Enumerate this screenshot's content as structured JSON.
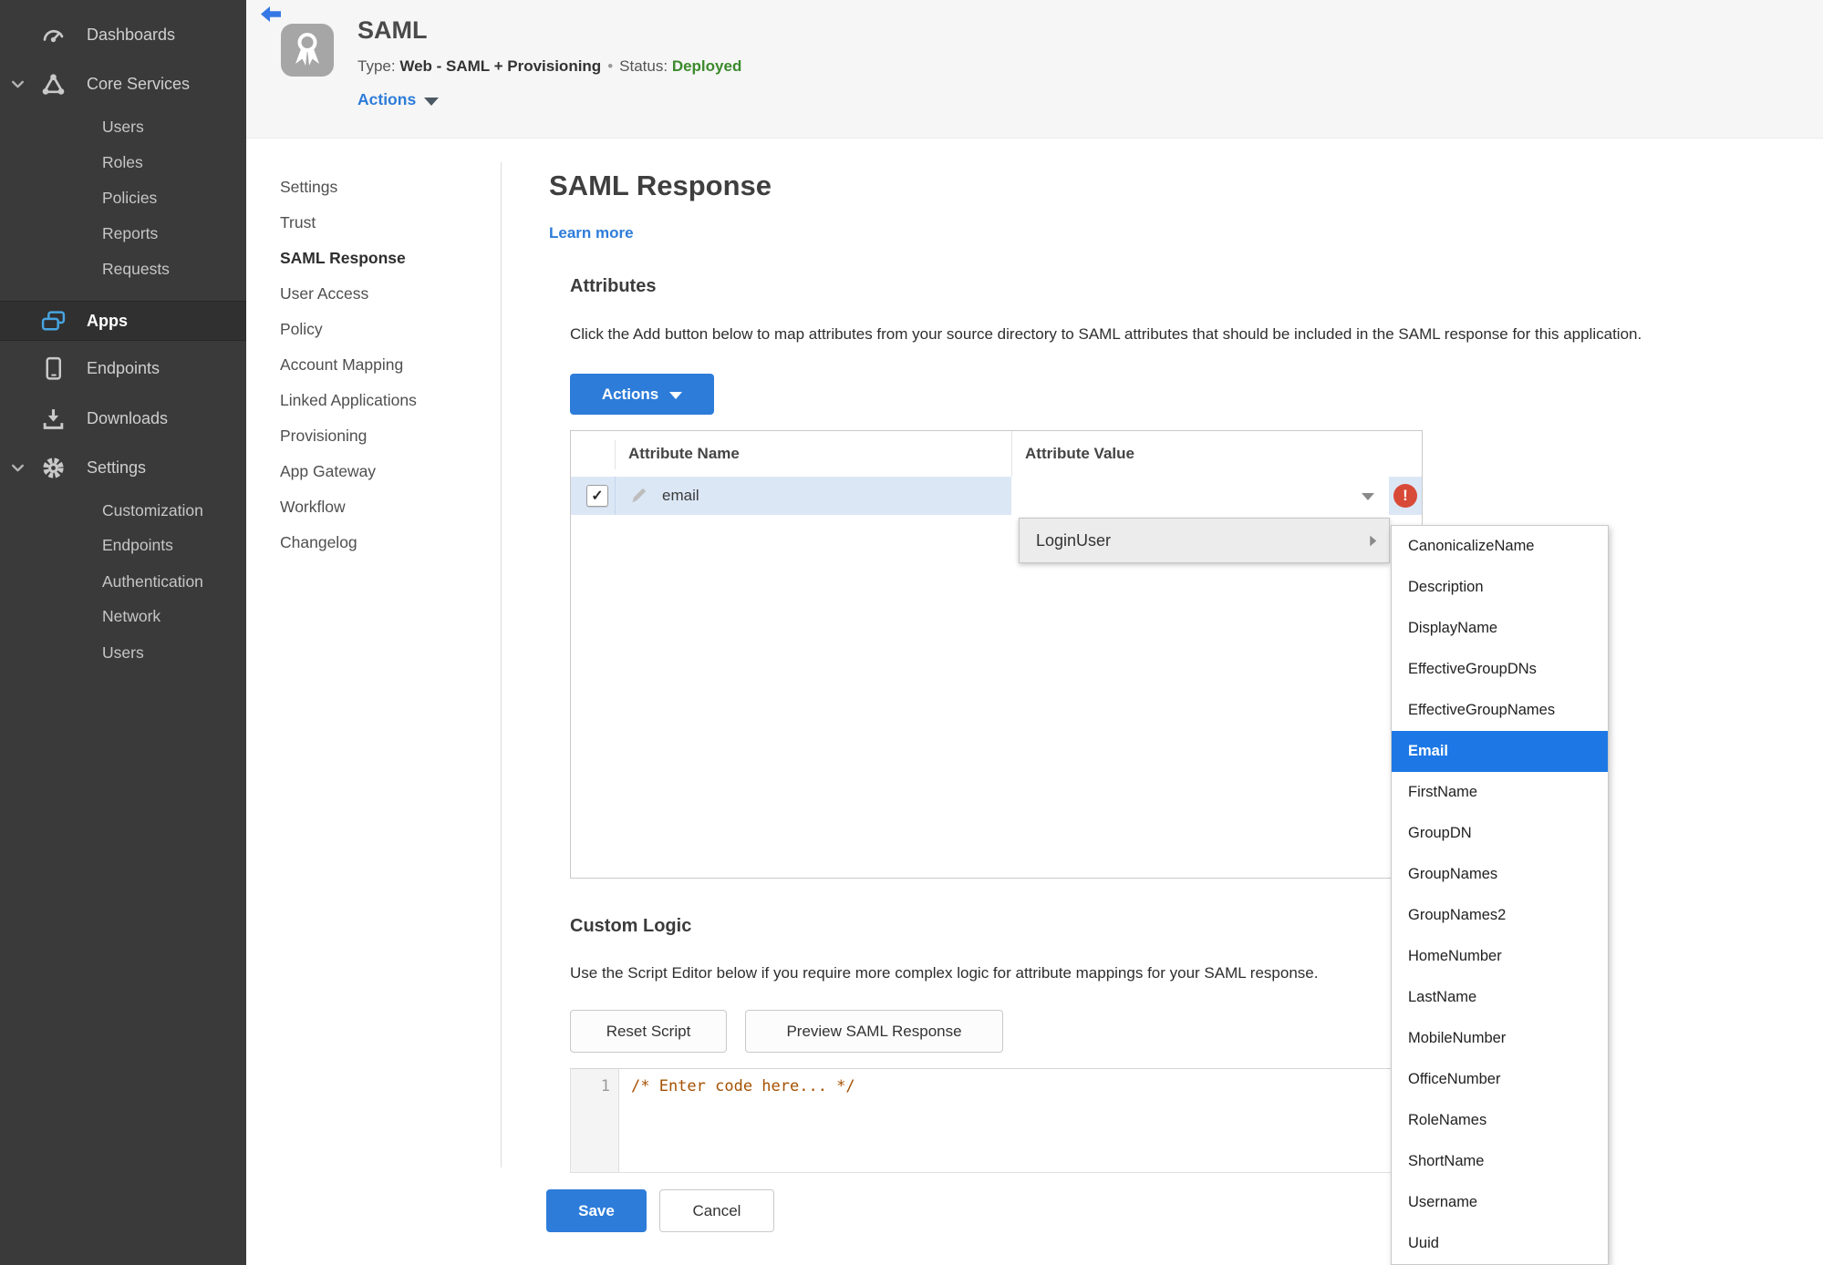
{
  "header": {
    "title": "SAML",
    "type_label": "Type:",
    "type_value": "Web - SAML + Provisioning",
    "separator": "•",
    "status_label": "Status:",
    "status_value": "Deployed",
    "actions_label": "Actions"
  },
  "sidebar": {
    "items": [
      {
        "label": "Dashboards",
        "icon": "gauge-icon"
      },
      {
        "label": "Core Services",
        "icon": "core-services-icon"
      },
      {
        "label": "Users"
      },
      {
        "label": "Roles"
      },
      {
        "label": "Policies"
      },
      {
        "label": "Reports"
      },
      {
        "label": "Requests"
      },
      {
        "label": "Apps",
        "icon": "apps-icon",
        "active": true
      },
      {
        "label": "Endpoints",
        "icon": "phone-icon"
      },
      {
        "label": "Downloads",
        "icon": "download-icon"
      },
      {
        "label": "Settings",
        "icon": "gear-icon"
      },
      {
        "label": "Customization"
      },
      {
        "label": "Endpoints"
      },
      {
        "label": "Authentication"
      },
      {
        "label": "Network"
      },
      {
        "label": "Users"
      }
    ]
  },
  "subnav": {
    "items": [
      {
        "label": "Settings"
      },
      {
        "label": "Trust"
      },
      {
        "label": "SAML Response",
        "active": true
      },
      {
        "label": "User Access"
      },
      {
        "label": "Policy"
      },
      {
        "label": "Account Mapping"
      },
      {
        "label": "Linked Applications"
      },
      {
        "label": "Provisioning"
      },
      {
        "label": "App Gateway"
      },
      {
        "label": "Workflow"
      },
      {
        "label": "Changelog"
      }
    ]
  },
  "main": {
    "title": "SAML Response",
    "learn_more": "Learn more",
    "attributes": {
      "heading": "Attributes",
      "description": "Click the Add button below to map attributes from your source directory to SAML attributes that should be included in the SAML response for this application.",
      "actions_button": "Actions",
      "table": {
        "columns": [
          "Attribute Name",
          "Attribute Value"
        ],
        "rows": [
          {
            "attribute_name": "email",
            "attribute_value": "",
            "checked": true,
            "error": true,
            "check_glyph": "✓",
            "error_glyph": "!"
          }
        ]
      }
    },
    "context_menu": {
      "label": "LoginUser",
      "submenu": {
        "selected": "Email",
        "items": [
          "CanonicalizeName",
          "Description",
          "DisplayName",
          "EffectiveGroupDNs",
          "EffectiveGroupNames",
          "Email",
          "FirstName",
          "GroupDN",
          "GroupNames",
          "GroupNames2",
          "HomeNumber",
          "LastName",
          "MobileNumber",
          "OfficeNumber",
          "RoleNames",
          "ShortName",
          "Username",
          "Uuid"
        ]
      }
    },
    "custom_logic": {
      "heading": "Custom Logic",
      "description": "Use the Script Editor below if you require more complex logic for attribute mappings for your SAML response.",
      "reset_button": "Reset Script",
      "preview_button": "Preview SAML Response",
      "editor": {
        "line_number": "1",
        "code": "/* Enter code here... */"
      }
    },
    "footer": {
      "save": "Save",
      "cancel": "Cancel"
    }
  },
  "colors": {
    "accent_blue": "#2d7cd9",
    "status_green": "#3c8a2d",
    "error_red": "#d84a38",
    "row_selection_blue": "#dce7f6",
    "menu_highlight_blue": "#1d78e5",
    "apps_icon_blue": "#47a4e0",
    "sidebar_bg": "#3a3a3a",
    "header_bg": "#f6f6f6",
    "code_comment_orange": "#a55000"
  }
}
